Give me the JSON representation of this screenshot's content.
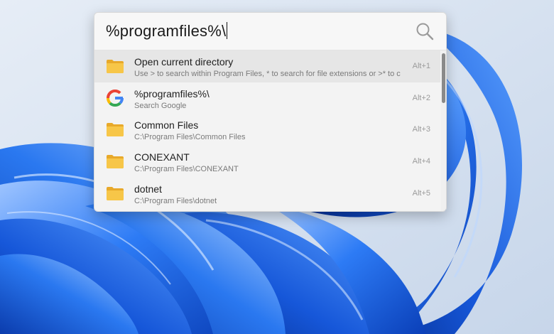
{
  "search": {
    "query": "%programfiles%\\"
  },
  "results": [
    {
      "title": "Open current directory",
      "subtitle": "Use > to search within Program Files, * to search for file extensions or >* to c",
      "hotkey": "Alt+1",
      "icon": "folder-icon"
    },
    {
      "title": "%programfiles%\\",
      "subtitle": "Search Google",
      "hotkey": "Alt+2",
      "icon": "google-icon"
    },
    {
      "title": "Common Files",
      "subtitle": "C:\\Program Files\\Common Files",
      "hotkey": "Alt+3",
      "icon": "folder-icon"
    },
    {
      "title": "CONEXANT",
      "subtitle": "C:\\Program Files\\CONEXANT",
      "hotkey": "Alt+4",
      "icon": "folder-icon"
    },
    {
      "title": "dotnet",
      "subtitle": "C:\\Program Files\\dotnet",
      "hotkey": "Alt+5",
      "icon": "folder-icon"
    }
  ],
  "colors": {
    "folder": "#f5c242",
    "selected_row": "#e6e6e6",
    "wallpaper_blue": "#1f6ff2"
  }
}
